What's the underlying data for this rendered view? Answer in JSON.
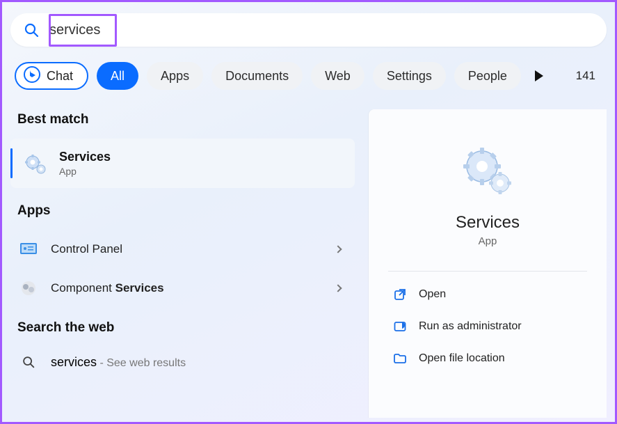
{
  "search": {
    "query": "services"
  },
  "filters": {
    "chat": "Chat",
    "all": "All",
    "apps": "Apps",
    "documents": "Documents",
    "web": "Web",
    "settings": "Settings",
    "people": "People"
  },
  "count_badge": "141",
  "sections": {
    "best_match": "Best match",
    "apps": "Apps",
    "search_web": "Search the web"
  },
  "best": {
    "title": "Services",
    "subtitle": "App"
  },
  "apps_list": {
    "control_panel": "Control Panel",
    "component_prefix": "Component ",
    "component_bold": "Services"
  },
  "web": {
    "query": "services",
    "hint": " - See web results"
  },
  "detail": {
    "title": "Services",
    "subtitle": "App",
    "actions": {
      "open": "Open",
      "run_admin": "Run as administrator",
      "open_loc": "Open file location"
    }
  }
}
